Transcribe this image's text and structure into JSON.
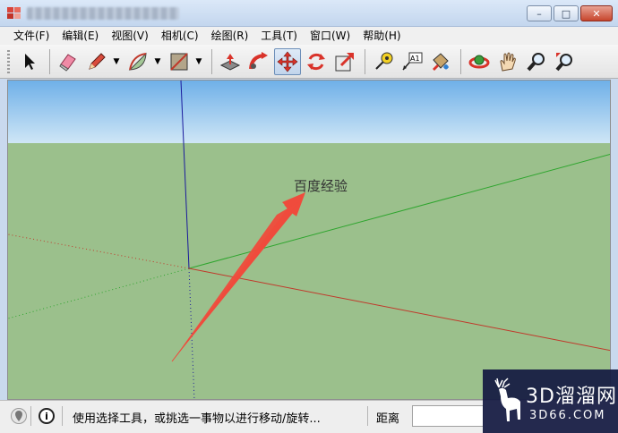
{
  "menu": {
    "items": [
      {
        "label": "文件(F)"
      },
      {
        "label": "编辑(E)"
      },
      {
        "label": "视图(V)"
      },
      {
        "label": "相机(C)"
      },
      {
        "label": "绘图(R)"
      },
      {
        "label": "工具(T)"
      },
      {
        "label": "窗口(W)"
      },
      {
        "label": "帮助(H)"
      }
    ]
  },
  "window": {
    "minimize_glyph": "–",
    "maximize_glyph": "□",
    "close_glyph": "✕"
  },
  "toolbar": {
    "icons": [
      "select-arrow-icon",
      "eraser-icon",
      "pencil-icon",
      "arc-icon",
      "rectangle-icon",
      "push-pull-icon",
      "follow-me-icon",
      "move-icon",
      "rotate-icon",
      "scale-icon",
      "tape-measure-icon",
      "text-label-icon",
      "paint-bucket-icon",
      "orbit-icon",
      "pan-hand-icon",
      "zoom-icon",
      "zoom-extents-icon"
    ],
    "text_tool_glyph": "A1",
    "active_tool": "move-icon"
  },
  "viewport": {
    "annotation": "百度经验",
    "colors": {
      "sky_top": "#6fb0e8",
      "sky_bottom": "#cfe6f6",
      "ground": "#9bc08c",
      "axis_red": "#c0392b",
      "axis_green": "#2ea52e",
      "axis_blue": "#1a1a9c",
      "arrow": "#ef4b3c"
    }
  },
  "status": {
    "message": "使用选择工具，或挑选一事物以进行移动/旋转...",
    "info_glyph": "i",
    "distance_label": "距离",
    "distance_value": ""
  },
  "watermark": {
    "main": "3D溜溜网",
    "sub": "3D66.COM"
  }
}
